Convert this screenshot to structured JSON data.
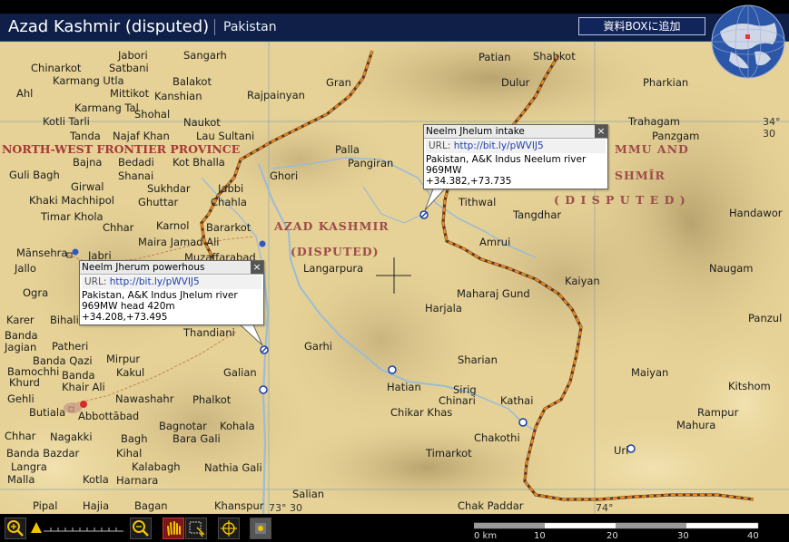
{
  "header": {
    "title": "Azad Kashmir (disputed)",
    "country": "Pakistan",
    "add_button": "資料BOXに追加"
  },
  "colors": {
    "header_bg": "#0f1f47",
    "map_land": "#e9d59a",
    "border_dash": "#f28a1e",
    "region_label": "#9e4b4b"
  },
  "regions": {
    "nwfp": "NORTH-WEST FRONTIER PROVINCE",
    "ak1": "AZAD KASHMIR",
    "ak2": "(DISPUTED)",
    "jk1": "MMU AND",
    "jk2": "SHMĪR",
    "jk3": "( D I S P U T E D )"
  },
  "places": {
    "jabori": "Jabori",
    "sangarh": "Sangarh",
    "chinarkot": "Chinarkot",
    "satbani": "Satbani",
    "karmangutla": "Karmang Utla",
    "balakot": "Balakot",
    "ahl": "Ahl",
    "mittikot": "Mittikot",
    "kanshian": "Kanshian",
    "rajpainyan": "Rajpainyan",
    "gran": "Gran",
    "patian": "Patian",
    "shahkot": "Shahkot",
    "dulur": "Dulur",
    "pharkian": "Pharkian",
    "karmangtal": "Karmang Tal",
    "shohal": "Shohal",
    "kotlitarli": "Kotli Tarli",
    "naukot": "Naukot",
    "tanda": "Tanda",
    "najafkhan": "Najaf Khan",
    "lausultani": "Lau Sultani",
    "trahagam": "Trahagam",
    "panzgam": "Panzgam",
    "palla": "Palla",
    "pangiran": "Pangiran",
    "bajna": "Bajna",
    "bedadi": "Bedadi",
    "kotbhalla": "Kot Bhalla",
    "gulibagh": "Guli Bagh",
    "shanai": "Shanai",
    "ghori": "Ghori",
    "girwal": "Girwal",
    "sukhdar": "Sukhdar",
    "jabbi": "Jabbi",
    "khakimachhipol": "Khaki Machhipol",
    "ghuttar": "Ghuttar",
    "chahla": "Chahla",
    "tithwal": "Tithwal",
    "handawor": "Handawor",
    "timarkhola": "Timar Khola",
    "tangdhar": "Tangdhar",
    "chhar1": "Chhar",
    "karnol": "Karnol",
    "bararkot": "Bararkot",
    "amrui": "Amrui",
    "mansehra": "Mānsehra",
    "jabri": "Jabri",
    "mairajamadali": "Maira Jamad Ali",
    "jallo": "Jallo",
    "muzaffarabad": "Muzaffarabad",
    "langarpura": "Langarpura",
    "naugam": "Naugam",
    "ogra": "Ogra",
    "kaiyan": "Kaiyan",
    "maharajgund": "Maharaj Gund",
    "harjala": "Harjala",
    "karer": "Karer",
    "bihali": "Bihali",
    "panzul": "Panzul",
    "banda": "Banda",
    "jagian": "Jagian",
    "patheri": "Patheri",
    "thandiani": "Thandiani",
    "garhi": "Garhi",
    "bandaqazi": "Banda Qazi",
    "mirpur": "Mirpur",
    "sharian": "Sharian",
    "bamochhi": "Bamochhi",
    "khurd": "Khurd",
    "banda2": "Banda",
    "kakul": "Kakul",
    "galian": "Galian",
    "maiyan": "Maiyan",
    "khairali": "Khair Ali",
    "hatian": "Hatian",
    "sirig": "Sirig",
    "kitshom": "Kitshom",
    "gehli": "Gehli",
    "nawashahr": "Nawashahr",
    "phalkot": "Phalkot",
    "chinari": "Chinari",
    "kathai": "Kathai",
    "butiala": "Butiala",
    "chikarkhas": "Chikar Khas",
    "rampur": "Rampur",
    "abbottabad": "Abbottābad",
    "bagnotar": "Bagnotar",
    "kohala": "Kohala",
    "mahura": "Mahura",
    "chhar2": "Chhar",
    "nagakki": "Nagakki",
    "bagh": "Bagh",
    "baragali": "Bara Gali",
    "chakothi": "Chakothi",
    "bandabazdar": "Banda Bazdar",
    "kihal": "Kihal",
    "timarkot": "Timarkot",
    "uri": "Uri",
    "langra": "Langra",
    "kalabagh": "Kalabagh",
    "nathiagali": "Nathia Gali",
    "malla": "Malla",
    "kotla": "Kotla",
    "harnara": "Harnara",
    "salian": "Salian",
    "pipal": "Pipal",
    "hajia": "Hajia",
    "bagan": "Bagan",
    "khanspur": "Khanspur",
    "chakpaddar": "Chak Paddar"
  },
  "edge_labels": {
    "lat_right": "34° 30",
    "lon_bottom1": "73° 30",
    "lon_bottom2": "74°"
  },
  "popup_jhelum_intake": {
    "title": "Neelm Jhelum intake",
    "url_label": "URL:",
    "url": "http://bit.ly/pWVIJ5",
    "line1": "Pakistan, A&K Indus Neelum river",
    "line2": "969MW",
    "line3": "+34.382,+73.735",
    "close": "×"
  },
  "popup_jherum_powerhouse": {
    "title": "Neelm Jherum powerhous",
    "url_label": "URL:",
    "url": "http://bit.ly/pWVIJ5",
    "line1": "Pakistan, A&K Indus Jhelum river",
    "line2": "969MW head 420m",
    "line3": "+34.208,+73.495",
    "close": "×"
  },
  "scale": {
    "labels": [
      "0 km",
      "10",
      "20",
      "30",
      "40"
    ]
  },
  "toolbar": {
    "icons": [
      "zoom-in-icon",
      "zoom-slider",
      "zoom-out-icon",
      "hand-pan-icon",
      "select-box-icon",
      "crosshair-target-icon",
      "layer-icon"
    ]
  }
}
